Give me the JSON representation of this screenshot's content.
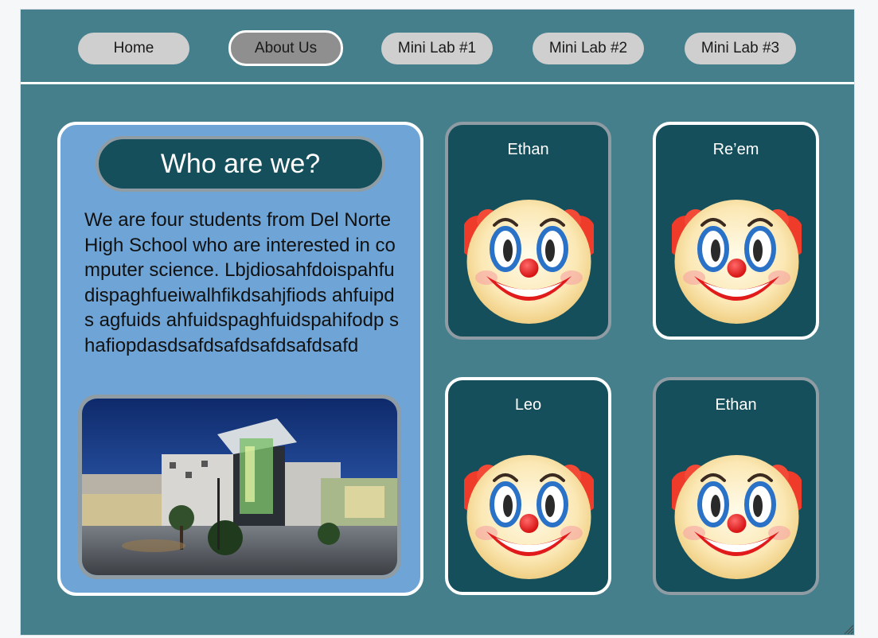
{
  "nav": {
    "items": [
      {
        "label": "Home",
        "active": false
      },
      {
        "label": "About Us",
        "active": true
      },
      {
        "label": "Mini Lab #1",
        "active": false
      },
      {
        "label": "Mini Lab #2",
        "active": false
      },
      {
        "label": "Mini Lab #3",
        "active": false
      }
    ]
  },
  "about": {
    "title": "Who are we?",
    "body": "We are four students from Del Norte High School who are interested in computer science. Lbjdiosahfdoispahfudispaghfueiwalhfikdsahjfiods ahfuipds agfuids ahfuidspaghfuidspahifodp shafiopdasdsafdsafdsafdsafdsafd"
  },
  "members": [
    {
      "name": "Ethan",
      "icon": "clown-face-icon"
    },
    {
      "name": "Re’em",
      "icon": "clown-face-icon"
    },
    {
      "name": "Leo",
      "icon": "clown-face-icon"
    },
    {
      "name": "Ethan",
      "icon": "clown-face-icon"
    }
  ],
  "colors": {
    "page_bg": "#467f8c",
    "nav_button": "#cfcfcf",
    "nav_button_active": "#8f8f8f",
    "about_card": "#6fa4d6",
    "dark_teal": "#154f5b",
    "border_grey": "#8f9ca3",
    "border_white": "#ffffff"
  }
}
